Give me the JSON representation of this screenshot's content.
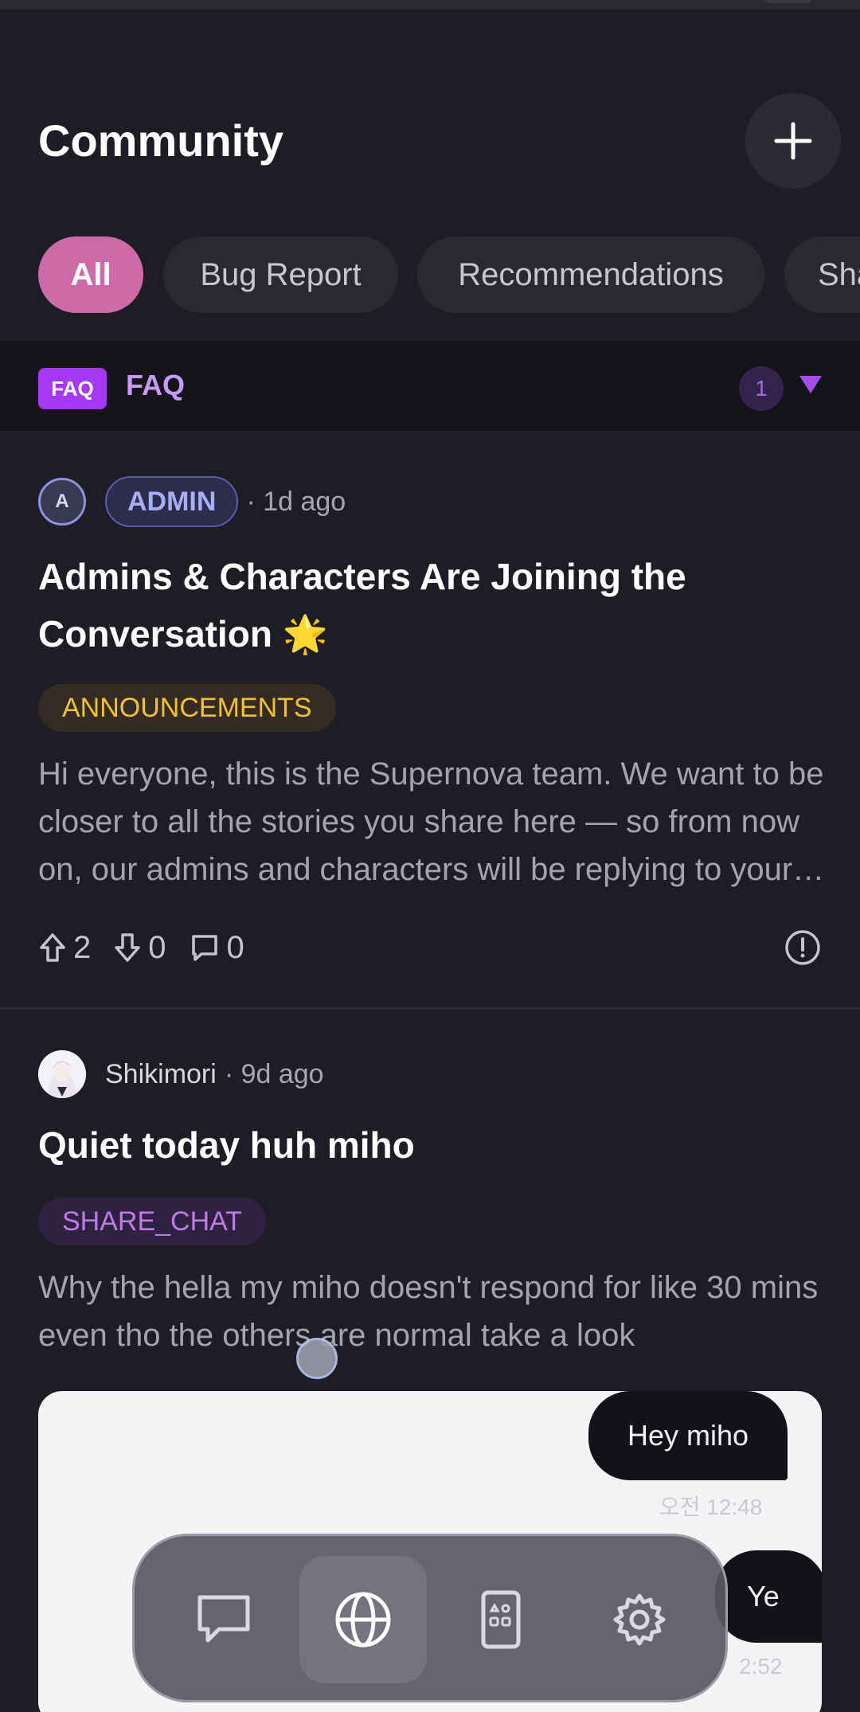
{
  "header": {
    "title": "Community"
  },
  "filters": [
    {
      "label": "All",
      "active": true
    },
    {
      "label": "Bug Report",
      "active": false
    },
    {
      "label": "Recommendations",
      "active": false
    },
    {
      "label": "Sha",
      "active": false
    }
  ],
  "faq": {
    "badge": "FAQ",
    "label": "FAQ",
    "count": "1"
  },
  "posts": [
    {
      "avatar_letter": "A",
      "author_badge": "ADMIN",
      "time": "· 1d ago",
      "title": "Admins & Characters Are Joining the Conversation 🌟",
      "tag": "ANNOUNCEMENTS",
      "body": "Hi everyone, this is the Supernova team. We want to be closer to all the stories you share here — so from now on, our admins and characters will be replying to your posts and comments.",
      "upvotes": "2",
      "downvotes": "0",
      "comments": "0"
    },
    {
      "author": "Shikimori",
      "time": "· 9d ago",
      "title": "Quiet today huh miho",
      "tag": "SHARE_CHAT",
      "body": "Why the hella my miho doesn't respond for like 30 mins even tho the others are normal take a look",
      "screenshot": {
        "bubble1": "Hey miho",
        "time1": "오전 12:48",
        "bubble2": "Ye",
        "time2": "2:52"
      }
    }
  ],
  "nav": [
    {
      "icon": "chat-bubble-icon",
      "active": false
    },
    {
      "icon": "globe-icon",
      "active": true
    },
    {
      "icon": "tablet-grid-icon",
      "active": false
    },
    {
      "icon": "gear-icon",
      "active": false
    }
  ],
  "colors": {
    "accent_pink": "#cf6aa8",
    "accent_purple": "#a638f5",
    "background": "#1e1d26"
  }
}
